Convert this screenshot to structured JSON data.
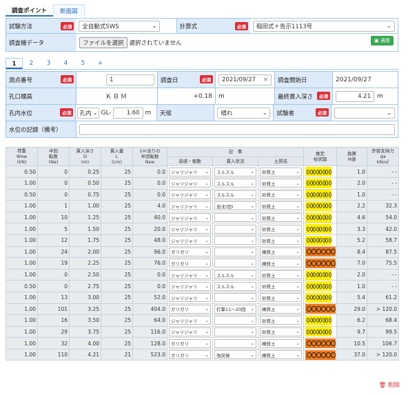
{
  "tabs": {
    "active": "調査ポイント",
    "other": "断面図"
  },
  "form": {
    "method_label": "試験方法",
    "method_value": "全自動式SWS",
    "calc_label": "計算式",
    "calc_value": "稲田式＋告示1113号",
    "data_label": "調査機データ",
    "file_button": "ファイルを選択",
    "file_status": "選択されていません",
    "apply_button": "適用",
    "required": "必須"
  },
  "num_tabs": [
    "1",
    "2",
    "3",
    "4",
    "5",
    "+"
  ],
  "point": {
    "no_label": "測点番号",
    "no_value": "1",
    "date_label": "調査日",
    "date_value": "2021/09/27",
    "start_label": "調査開始日",
    "start_value": "2021/09/27",
    "elev_label": "孔口標高",
    "elev_ref": "ＫＢＭ",
    "elev_value": "+0.18",
    "elev_unit": "m",
    "depth_label": "最終貫入深さ",
    "depth_value": "4.21",
    "depth_unit": "m",
    "water_label": "孔内水位",
    "water_sel": "孔内",
    "water_gl": "GL-",
    "water_value": "1.60",
    "water_unit": "m",
    "weather_label": "天候",
    "weather_value": "晴れ",
    "tester_label": "試験者",
    "tester_value": "",
    "note_label": "水位の記録（備考）",
    "note_value": ""
  },
  "grid": {
    "headers": {
      "wsw": "荷重\nWsw\n(kN)",
      "na": "半回\n転数\n(Na)",
      "d": "貫入深さ\nD\n(m)",
      "l": "貫入量\nL\n(cm)",
      "nsw": "1m当りの\n半回転数\nNsw",
      "record": "記　事",
      "sound": "音感・振動",
      "pen": "貫入状況",
      "soil": "土質名",
      "chart": "推定\n柱状図",
      "n": "換算\nN値",
      "qa": "許容支持力\nqa\nkN/㎡"
    },
    "rows": [
      {
        "wsw": "0.50",
        "na": "0",
        "d": "0.25",
        "l": "25",
        "nsw": "0.0",
        "sound": "ジャリジャリ",
        "pen": "スルスル",
        "soil": "砂質土",
        "circles": 8,
        "color": "yellow",
        "n": "1.0",
        "qa": "- -"
      },
      {
        "wsw": "1.00",
        "na": "0",
        "d": "0.50",
        "l": "25",
        "nsw": "0.0",
        "sound": "ジャリジャリ",
        "pen": "スルスル",
        "soil": "砂質土",
        "circles": 8,
        "color": "yellow",
        "n": "2.0",
        "qa": "- -"
      },
      {
        "wsw": "0.50",
        "na": "0",
        "d": "0.75",
        "l": "25",
        "nsw": "0.0",
        "sound": "ジャリジャリ",
        "pen": "スルスル",
        "soil": "砂質土",
        "circles": 8,
        "color": "yellow",
        "n": "1.0",
        "qa": "- -"
      },
      {
        "wsw": "1.00",
        "na": "1",
        "d": "1.00",
        "l": "25",
        "nsw": "4.0",
        "sound": "ジャリジャリ",
        "pen": "自沈(回)",
        "soil": "砂質土",
        "circles": 8,
        "color": "yellow",
        "n": "2.2",
        "qa": "32.3"
      },
      {
        "wsw": "1.00",
        "na": "10",
        "d": "1.25",
        "l": "25",
        "nsw": "40.0",
        "sound": "ジャリジャリ",
        "pen": "",
        "soil": "砂質土",
        "circles": 8,
        "color": "yellow",
        "n": "4.6",
        "qa": "54.0"
      },
      {
        "wsw": "1.00",
        "na": "5",
        "d": "1.50",
        "l": "25",
        "nsw": "20.0",
        "sound": "ジャリジャリ",
        "pen": "",
        "soil": "砂質土",
        "circles": 8,
        "color": "yellow",
        "n": "3.3",
        "qa": "42.0"
      },
      {
        "wsw": "1.00",
        "na": "12",
        "d": "1.75",
        "l": "25",
        "nsw": "48.0",
        "sound": "ジャリジャリ",
        "pen": "",
        "soil": "砂質土",
        "circles": 8,
        "color": "yellow",
        "n": "5.2",
        "qa": "58.7"
      },
      {
        "wsw": "1.00",
        "na": "24",
        "d": "2.00",
        "l": "25",
        "nsw": "96.0",
        "sound": "ガリガリ",
        "pen": "",
        "soil": "礫質土",
        "circles": 6,
        "color": "orange",
        "n": "8.4",
        "qa": "87.5"
      },
      {
        "wsw": "1.00",
        "na": "19",
        "d": "2.25",
        "l": "25",
        "nsw": "76.0",
        "sound": "ガリガリ",
        "pen": "",
        "soil": "礫質土",
        "circles": 6,
        "color": "orange",
        "n": "7.0",
        "qa": "75.5"
      },
      {
        "wsw": "1.00",
        "na": "0",
        "d": "2.50",
        "l": "25",
        "nsw": "0.0",
        "sound": "ジャリジャリ",
        "pen": "スルスル",
        "soil": "砂質土",
        "circles": 8,
        "color": "yellow",
        "n": "2.0",
        "qa": "- -"
      },
      {
        "wsw": "0.50",
        "na": "0",
        "d": "2.75",
        "l": "25",
        "nsw": "0.0",
        "sound": "ジャリジャリ",
        "pen": "スルスル",
        "soil": "砂質土",
        "circles": 8,
        "color": "yellow",
        "n": "1.0",
        "qa": "- -"
      },
      {
        "wsw": "1.00",
        "na": "13",
        "d": "3.00",
        "l": "25",
        "nsw": "52.0",
        "sound": "ジャリジャリ",
        "pen": "",
        "soil": "砂質土",
        "circles": 8,
        "color": "yellow",
        "n": "5.4",
        "qa": "61.2"
      },
      {
        "wsw": "1.00",
        "na": "101",
        "d": "3.25",
        "l": "25",
        "nsw": "404.0",
        "sound": "ガリガリ",
        "pen": "打撃11〜20回",
        "soil": "礫質土",
        "circles": 6,
        "color": "orange",
        "n": "29.0",
        "qa": "> 120.0"
      },
      {
        "wsw": "1.00",
        "na": "16",
        "d": "3.50",
        "l": "25",
        "nsw": "64.0",
        "sound": "ジャリジャリ",
        "pen": "",
        "soil": "砂質土",
        "circles": 8,
        "color": "yellow",
        "n": "6.2",
        "qa": "68.4"
      },
      {
        "wsw": "1.00",
        "na": "29",
        "d": "3.75",
        "l": "25",
        "nsw": "116.0",
        "sound": "ジャリジャリ",
        "pen": "",
        "soil": "砂質土",
        "circles": 8,
        "color": "yellow",
        "n": "9.7",
        "qa": "99.5"
      },
      {
        "wsw": "1.00",
        "na": "32",
        "d": "4.00",
        "l": "25",
        "nsw": "128.0",
        "sound": "ガリガリ",
        "pen": "",
        "soil": "礫質土",
        "circles": 6,
        "color": "orange",
        "n": "10.5",
        "qa": "106.7"
      },
      {
        "wsw": "1.00",
        "na": "110",
        "d": "4.21",
        "l": "21",
        "nsw": "523.0",
        "sound": "ガリガリ",
        "pen": "強突発",
        "soil": "礫質土",
        "circles": 6,
        "color": "orange",
        "n": "37.0",
        "qa": "> 120.0"
      }
    ]
  },
  "colors": {
    "yellow": "#ffee00",
    "orange": "#f07a1a",
    "accent": "#2a6ebd",
    "danger": "#d9303a"
  },
  "delete_label": "削除"
}
